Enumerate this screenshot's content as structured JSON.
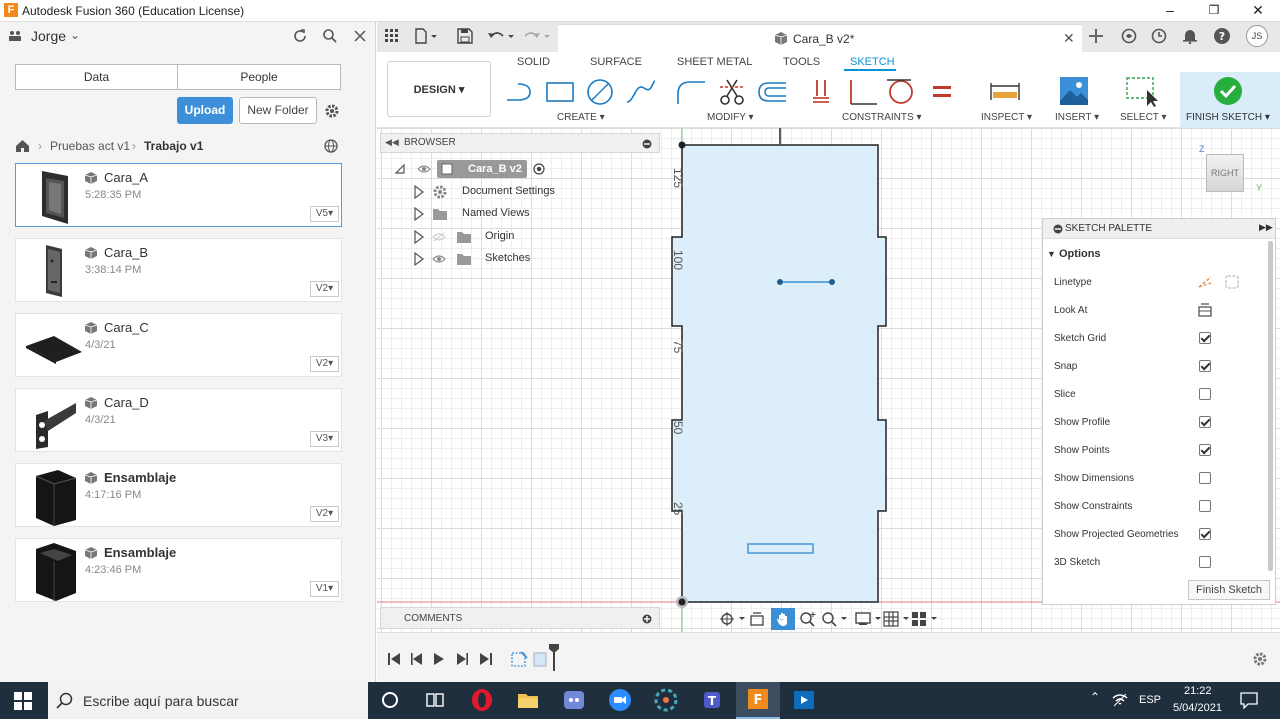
{
  "window": {
    "title": "Autodesk Fusion 360 (Education License)",
    "app_icon": "F"
  },
  "datapanel": {
    "user": "Jorge",
    "tabs": [
      "Data",
      "People"
    ],
    "upload": "Upload",
    "new_folder": "New Folder",
    "breadcrumb": [
      "Pruebas act v1",
      "Trabajo v1"
    ],
    "items": [
      {
        "name": "Cara_A",
        "time": "5:28:35 PM",
        "version": "V5"
      },
      {
        "name": "Cara_B",
        "time": "3:38:14 PM",
        "version": "V2"
      },
      {
        "name": "Cara_C",
        "time": "4/3/21",
        "version": "V2"
      },
      {
        "name": "Cara_D",
        "time": "4/3/21",
        "version": "V3"
      },
      {
        "name": "Ensamblaje",
        "time": "4:17:16 PM",
        "version": "V2"
      },
      {
        "name": "Ensamblaje",
        "time": "4:23:46 PM",
        "version": "V1"
      }
    ]
  },
  "document": {
    "tab": "Cara_B v2*",
    "user_initials": "JS"
  },
  "toolbar": {
    "workspace": "DESIGN",
    "tabs": [
      "SOLID",
      "SURFACE",
      "SHEET METAL",
      "TOOLS",
      "SKETCH"
    ],
    "active_tab": "SKETCH",
    "groups": [
      "CREATE",
      "MODIFY",
      "CONSTRAINTS",
      "INSPECT",
      "INSERT",
      "SELECT",
      "FINISH SKETCH"
    ],
    "accent": "#0696d7"
  },
  "browser": {
    "title": "BROWSER",
    "root": "Cara_B v2",
    "nodes": [
      "Document Settings",
      "Named Views",
      "Origin",
      "Sketches"
    ]
  },
  "comments": {
    "title": "COMMENTS"
  },
  "sketch": {
    "dimensions": [
      "125",
      "100",
      "75",
      "50",
      "25"
    ]
  },
  "viewcube": {
    "face": "RIGHT",
    "axis_z": "Z",
    "axis_y": "Y"
  },
  "palette": {
    "title": "SKETCH PALETTE",
    "section": "Options",
    "options": [
      {
        "label": "Linetype",
        "type": "icon"
      },
      {
        "label": "Look At",
        "type": "icon"
      },
      {
        "label": "Sketch Grid",
        "checked": true
      },
      {
        "label": "Snap",
        "checked": true
      },
      {
        "label": "Slice",
        "checked": false
      },
      {
        "label": "Show Profile",
        "checked": true
      },
      {
        "label": "Show Points",
        "checked": true
      },
      {
        "label": "Show Dimensions",
        "checked": false
      },
      {
        "label": "Show Constraints",
        "checked": false
      },
      {
        "label": "Show Projected Geometries",
        "checked": true
      },
      {
        "label": "3D Sketch",
        "checked": false
      }
    ],
    "finish": "Finish Sketch"
  },
  "taskbar": {
    "search_placeholder": "Escribe aquí para buscar",
    "lang": "ESP",
    "time": "21:22",
    "date": "5/04/2021"
  }
}
